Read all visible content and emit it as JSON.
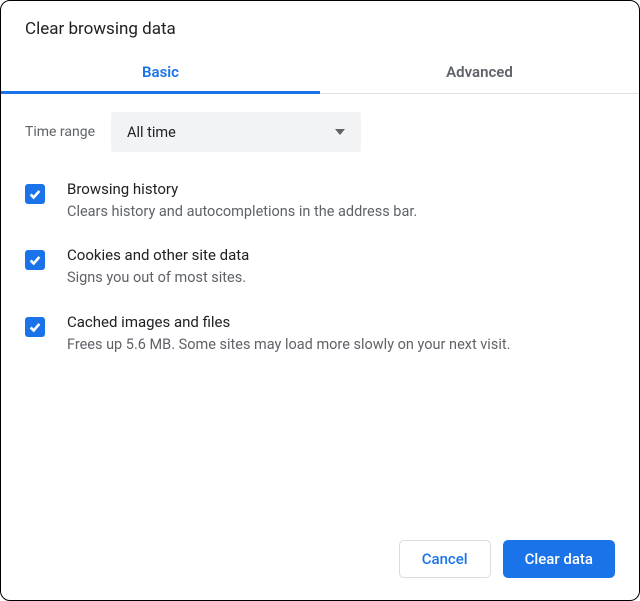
{
  "dialog": {
    "title": "Clear browsing data"
  },
  "tabs": {
    "basic": "Basic",
    "advanced": "Advanced"
  },
  "timeRange": {
    "label": "Time range",
    "selected": "All time"
  },
  "options": [
    {
      "title": "Browsing history",
      "description": "Clears history and autocompletions in the address bar."
    },
    {
      "title": "Cookies and other site data",
      "description": "Signs you out of most sites."
    },
    {
      "title": "Cached images and files",
      "description": "Frees up 5.6 MB. Some sites may load more slowly on your next visit."
    }
  ],
  "buttons": {
    "cancel": "Cancel",
    "clear": "Clear data"
  }
}
